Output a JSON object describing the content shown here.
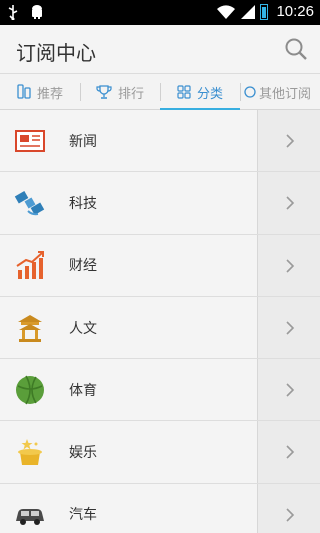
{
  "status": {
    "time": "10:26"
  },
  "header": {
    "title": "订阅中心"
  },
  "tabs": [
    {
      "label": "推荐",
      "icon": "phone-icon"
    },
    {
      "label": "排行",
      "icon": "trophy-icon"
    },
    {
      "label": "分类",
      "icon": "grid-icon",
      "active": true
    },
    {
      "label": "其他订阅",
      "icon": "circle-icon"
    }
  ],
  "categories": [
    {
      "label": "新闻",
      "icon": "newspaper-icon"
    },
    {
      "label": "科技",
      "icon": "satellite-icon"
    },
    {
      "label": "财经",
      "icon": "chart-up-icon"
    },
    {
      "label": "人文",
      "icon": "pavilion-icon"
    },
    {
      "label": "体育",
      "icon": "basketball-icon"
    },
    {
      "label": "娱乐",
      "icon": "magic-hat-icon"
    },
    {
      "label": "汽车",
      "icon": "car-icon"
    }
  ],
  "colors": {
    "accent": "#37aee0",
    "battery": "#33b5e5"
  }
}
